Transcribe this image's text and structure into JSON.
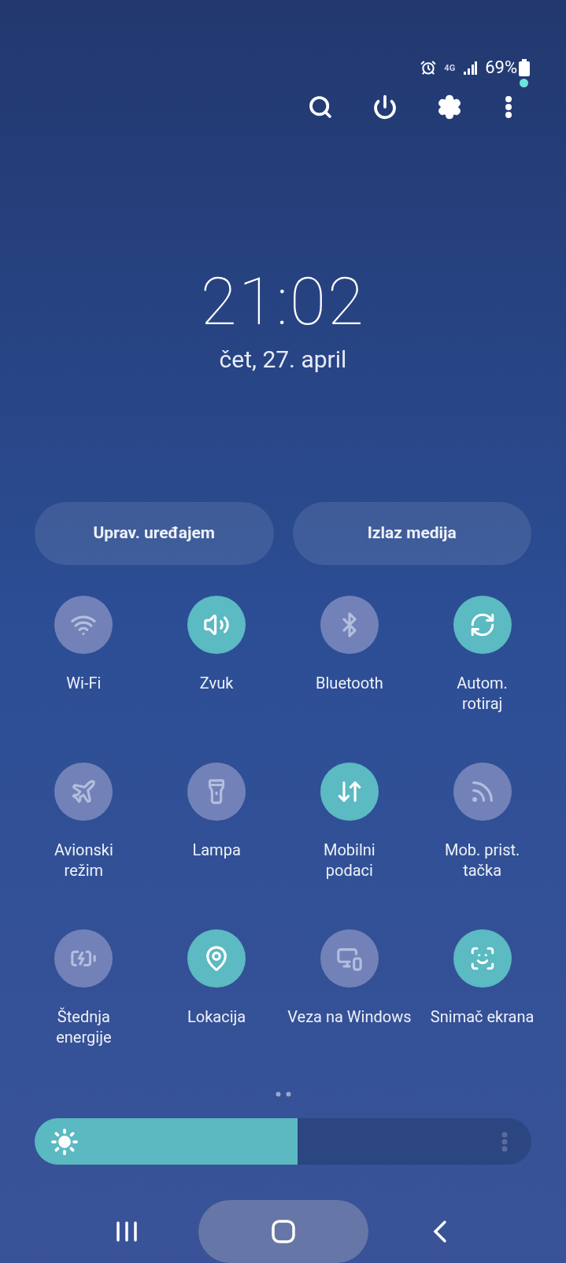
{
  "status_bar": {
    "network": "4G",
    "battery": "69%"
  },
  "header": {
    "notification_dot": true
  },
  "clock": {
    "time": "21:02",
    "date": "čet, 27. april"
  },
  "buttons": [
    "Uprav. uređajem",
    "Izlaz medija"
  ],
  "tiles": [
    {
      "label": "Wi-Fi",
      "on": false
    },
    {
      "label": "Zvuk",
      "on": true
    },
    {
      "label": "Bluetooth",
      "on": false
    },
    {
      "label": "Autom.\nrotiraj",
      "on": true
    },
    {
      "label": "Avionski\nrežim",
      "on": false
    },
    {
      "label": "Lampa",
      "on": false
    },
    {
      "label": "Mobilni\npodaci",
      "on": true
    },
    {
      "label": "Mob. prist.\ntačka",
      "on": false
    },
    {
      "label": "Štednja\nenergije",
      "on": false
    },
    {
      "label": "Lokacija",
      "on": true
    },
    {
      "label": "Veza na Windows",
      "on": false
    },
    {
      "label": "Snimač ekrana",
      "on": true
    }
  ],
  "brightness": {
    "level": 0.53
  }
}
